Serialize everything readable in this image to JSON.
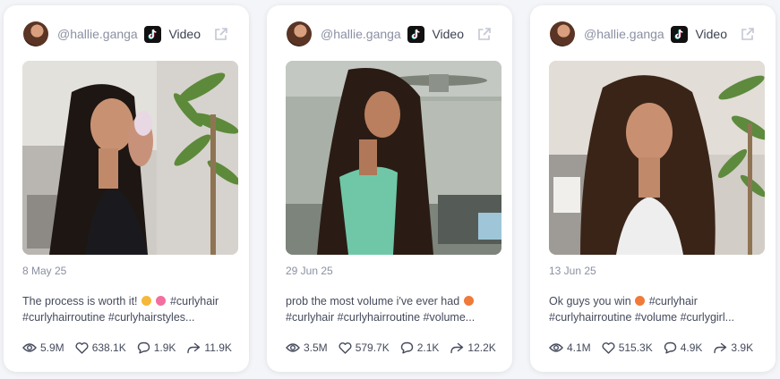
{
  "posts": [
    {
      "handle": "@hallie.ganga",
      "media_type": "Video",
      "platform_icon": "tiktok-icon",
      "date": "8 May 25",
      "caption_line1_a": "The process is worth it!",
      "caption_line1_b": "#curlyhair",
      "caption_line2": "#curlyhairroutine #curlyhairstyles...",
      "views": "5.9M",
      "likes": "638.1K",
      "comments": "1.9K",
      "shares": "11.9K"
    },
    {
      "handle": "@hallie.ganga",
      "media_type": "Video",
      "platform_icon": "tiktok-icon",
      "date": "29 Jun 25",
      "caption_line1_a": "prob the most volume i've ever had",
      "caption_line1_b": "",
      "caption_line2": "#curlyhair #curlyhairroutine #volume...",
      "views": "3.5M",
      "likes": "579.7K",
      "comments": "2.1K",
      "shares": "12.2K"
    },
    {
      "handle": "@hallie.ganga",
      "media_type": "Video",
      "platform_icon": "tiktok-icon",
      "date": "13 Jun 25",
      "caption_line1_a": "Ok guys you win",
      "caption_line1_b": "#curlyhair",
      "caption_line2": "#curlyhairroutine #volume #curlygirl...",
      "views": "4.1M",
      "likes": "515.3K",
      "comments": "4.9K",
      "shares": "3.9K"
    }
  ]
}
